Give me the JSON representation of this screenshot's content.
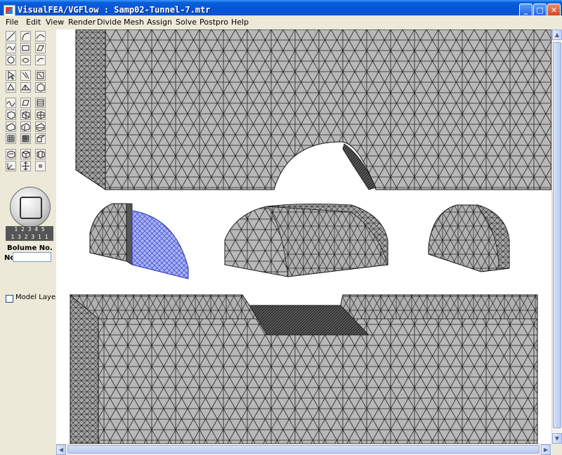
{
  "window": {
    "title": "VisualFEA/VGFlow :  Samp02-Tunnel-7.mtr",
    "minimize": "_",
    "maximize": "□",
    "close": "✕"
  },
  "menu": [
    "File",
    "Edit",
    "View",
    "Render",
    "Divide",
    "Mesh",
    "Assign",
    "Solve",
    "Postpro",
    "Help"
  ],
  "toolbar": {
    "icons": [
      "line-icon",
      "arc-icon",
      "curve-icon",
      "spline-icon",
      "rectangle-icon",
      "surface-icon",
      "circle-icon",
      "torus-icon",
      "sweep-icon",
      "select-arrow-icon",
      "select-edge-icon",
      "select-face-icon",
      "pick-node-icon",
      "pick-face-icon",
      "pick-volume-icon",
      "path-icon",
      "shell-icon",
      "table-icon",
      "cube-solid-icon",
      "cube-mesh-icon",
      "cube-grid-icon",
      "box-icon",
      "box-mesh-icon",
      "box-grid-icon",
      "grid-icon",
      "grid-dense-icon",
      "face-icon",
      "mesh-block-icon",
      "mesh-solid-icon",
      "mesh-dense-icon",
      "axis-icon",
      "move-icon",
      "point-icon"
    ],
    "ruler_top": "1 2 3 4 5",
    "ruler_bottom": "1 3 2 3 1 1",
    "volume_label": "Bolume No.",
    "no_label": "No",
    "no_value": "",
    "model_layer_label": "Model Layer"
  },
  "colors": {
    "mesh_fill": "#b8b8b8",
    "mesh_line": "#202020",
    "selected_mesh": "#5566dd"
  }
}
